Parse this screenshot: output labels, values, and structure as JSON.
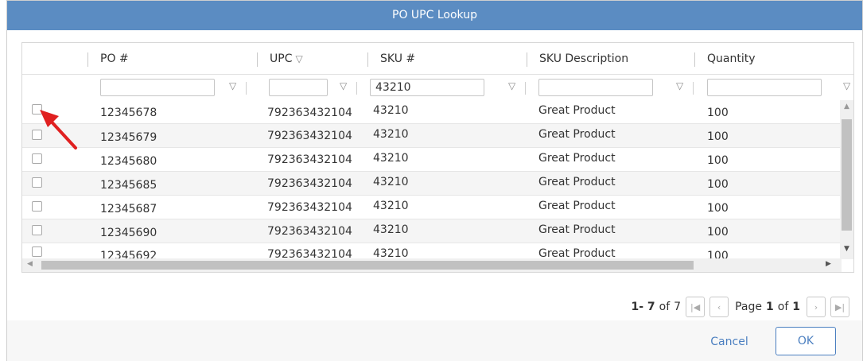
{
  "dialog": {
    "title": "PO UPC Lookup"
  },
  "columns": [
    {
      "key": "po",
      "label": "PO #"
    },
    {
      "key": "upc",
      "label": "UPC"
    },
    {
      "key": "sku",
      "label": "SKU #"
    },
    {
      "key": "desc",
      "label": "SKU Description"
    },
    {
      "key": "qty",
      "label": "Quantity"
    }
  ],
  "filters": {
    "po": "",
    "upc": "",
    "sku": "43210",
    "desc": "",
    "qty": ""
  },
  "rows": [
    {
      "po": "12345678",
      "upc": "792363432104",
      "sku": "43210",
      "desc": "Great Product",
      "qty": "100"
    },
    {
      "po": "12345679",
      "upc": "792363432104",
      "sku": "43210",
      "desc": "Great Product",
      "qty": "100"
    },
    {
      "po": "12345680",
      "upc": "792363432104",
      "sku": "43210",
      "desc": "Great Product",
      "qty": "100"
    },
    {
      "po": "12345685",
      "upc": "792363432104",
      "sku": "43210",
      "desc": "Great Product",
      "qty": "100"
    },
    {
      "po": "12345687",
      "upc": "792363432104",
      "sku": "43210",
      "desc": "Great Product",
      "qty": "100"
    },
    {
      "po": "12345690",
      "upc": "792363432104",
      "sku": "43210",
      "desc": "Great Product",
      "qty": "100"
    },
    {
      "po": "12345692",
      "upc": "792363432104",
      "sku": "43210",
      "desc": "Great Product",
      "qty": "100"
    }
  ],
  "pager": {
    "range": "1- 7",
    "of_label": "of",
    "total": "7",
    "page_label": "Page",
    "page": "1",
    "page_of_label": "of",
    "pages": "1"
  },
  "footer": {
    "cancel_label": "Cancel",
    "ok_label": "OK"
  },
  "colors": {
    "title_bar": "#5b8cc2",
    "accent": "#4b7fc0",
    "annotation_arrow": "#e02020"
  },
  "icons": [
    "filter-icon",
    "first-page-icon",
    "prev-page-icon",
    "next-page-icon",
    "last-page-icon",
    "scroll-up-icon",
    "scroll-down-icon",
    "scroll-left-icon",
    "scroll-right-icon",
    "annotation-arrow"
  ]
}
